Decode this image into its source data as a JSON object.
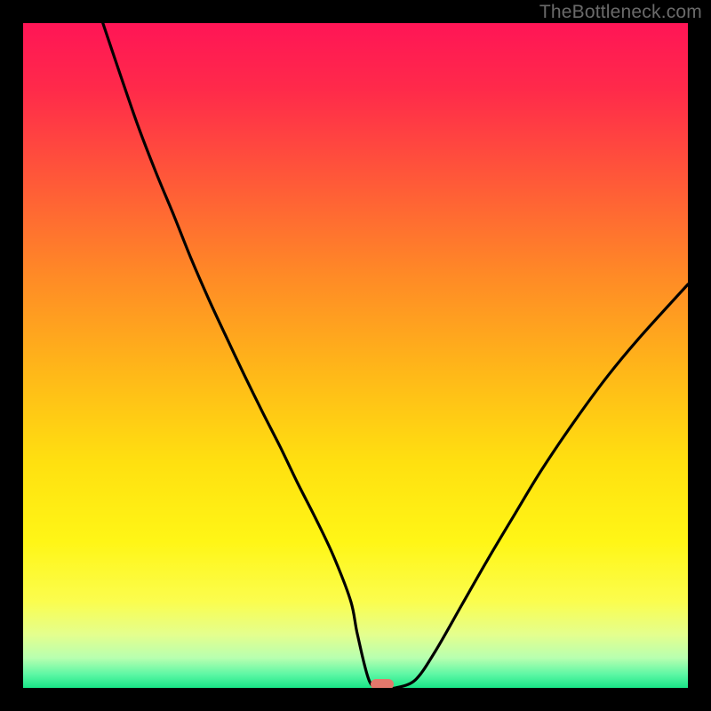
{
  "attribution": "TheBottleneck.com",
  "chart_data": {
    "type": "line",
    "title": "",
    "xlabel": "",
    "ylabel": "",
    "xlim": [
      0,
      100
    ],
    "ylim": [
      0,
      100
    ],
    "series": [
      {
        "name": "bottleneck-curve",
        "x": [
          12.0,
          14.7,
          17.3,
          20.0,
          22.7,
          25.3,
          28.0,
          30.7,
          33.3,
          36.0,
          38.7,
          41.3,
          44.0,
          46.7,
          49.3,
          50.3,
          52.1,
          54.0,
          56.0,
          59.0,
          62.0,
          66.0,
          70.0,
          74.0,
          78.0,
          83.0,
          88.0,
          93.0,
          100.0
        ],
        "y": [
          100.0,
          92.0,
          84.5,
          77.5,
          71.0,
          64.5,
          58.3,
          52.5,
          47.0,
          41.5,
          36.2,
          30.8,
          25.5,
          19.8,
          13.0,
          8.0,
          1.0,
          0.0,
          0.0,
          1.2,
          5.5,
          12.5,
          19.5,
          26.2,
          32.8,
          40.2,
          47.0,
          53.0,
          60.7
        ]
      }
    ],
    "marker": {
      "x": 54.0,
      "y": 0.5,
      "width_pct": 3.6,
      "height_pct": 1.6,
      "color": "#e2786c"
    },
    "gradient_stops": [
      {
        "offset": 0.0,
        "color": "#ff1556"
      },
      {
        "offset": 0.1,
        "color": "#ff2a4a"
      },
      {
        "offset": 0.24,
        "color": "#ff5a38"
      },
      {
        "offset": 0.38,
        "color": "#ff8a26"
      },
      {
        "offset": 0.52,
        "color": "#ffb619"
      },
      {
        "offset": 0.66,
        "color": "#ffe010"
      },
      {
        "offset": 0.78,
        "color": "#fff616"
      },
      {
        "offset": 0.87,
        "color": "#fbfd4e"
      },
      {
        "offset": 0.92,
        "color": "#e4ff8e"
      },
      {
        "offset": 0.955,
        "color": "#b8ffb0"
      },
      {
        "offset": 0.98,
        "color": "#5cf7a4"
      },
      {
        "offset": 1.0,
        "color": "#19e587"
      }
    ]
  }
}
